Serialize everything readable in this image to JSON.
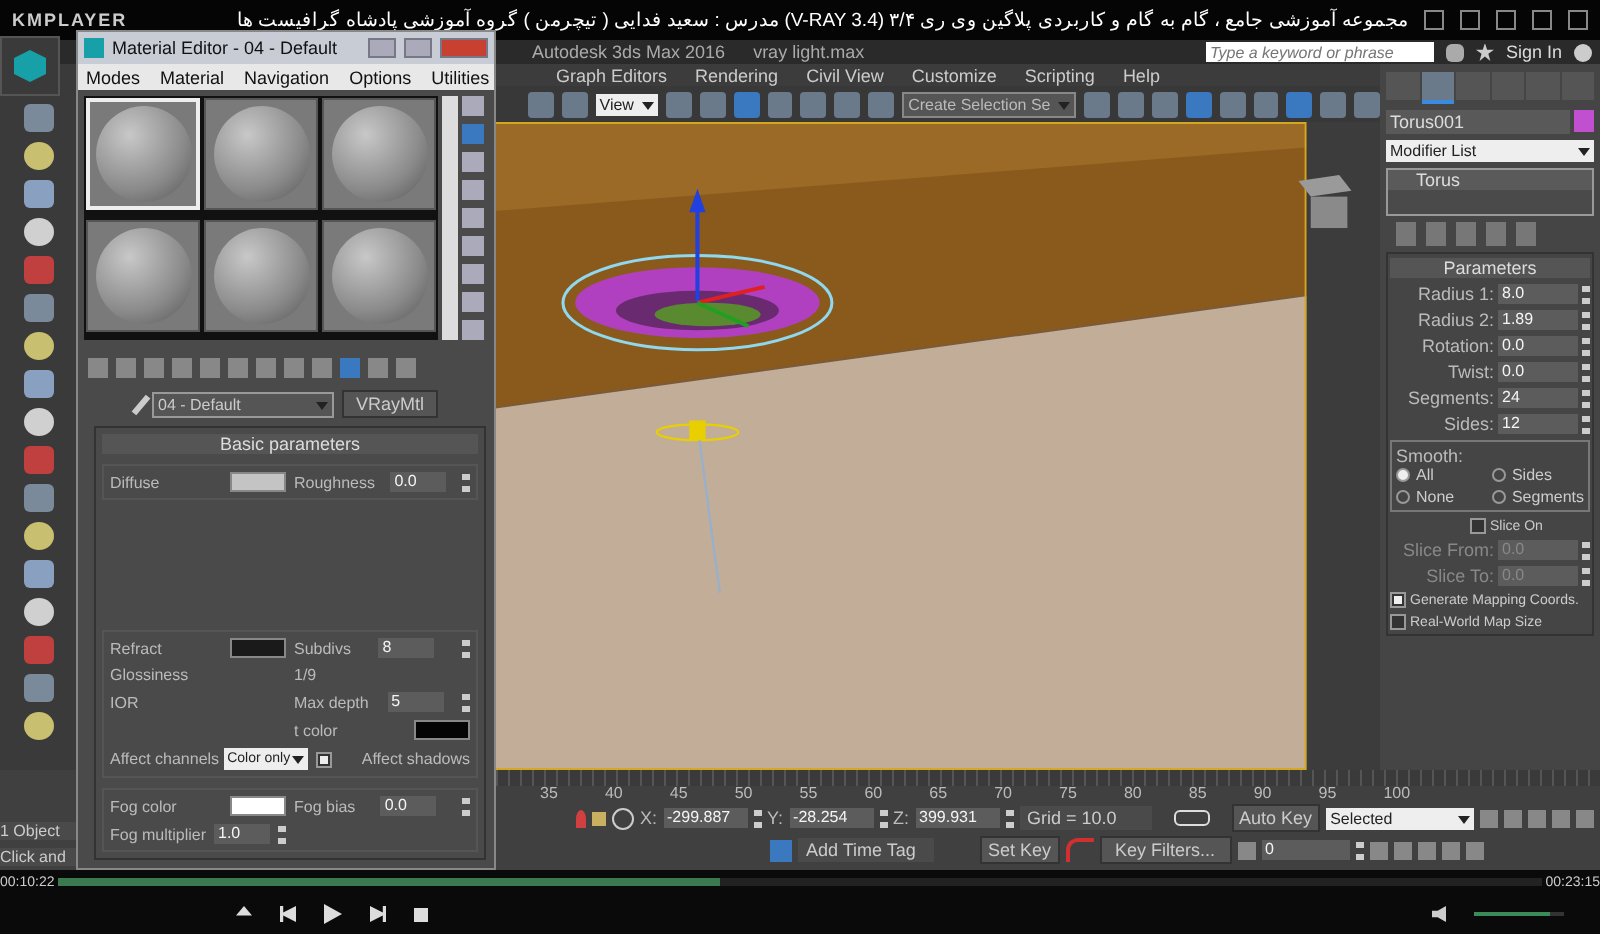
{
  "player": {
    "brand": "KMPLAYER",
    "title": "مجموعه آموزشی جامع ، گام به گام و کاربردی پلاگین وی ری ۳/۴ (V-RAY 3.4) مدرس : سعید فدایی ( تیچرمن ) گروه آموزشی پادشاه گرافیست ها",
    "time_elapsed": "00:10:22",
    "time_total": "00:23:15",
    "progress": {
      "level": 0.446
    },
    "volume": {
      "level": 0.85
    }
  },
  "app": {
    "title": "Autodesk 3ds Max 2016",
    "file": "vray light.max",
    "search": {
      "placeholder": "Type a keyword or phrase"
    },
    "sign_in": "Sign In"
  },
  "menu": [
    "Graph Editors",
    "Rendering",
    "Civil View",
    "Customize",
    "Scripting",
    "Help"
  ],
  "toolbar": {
    "view_dropdown": "View",
    "selection_set": "Create Selection Se"
  },
  "material_editor": {
    "title": "Material Editor - 04 - Default",
    "menu": [
      "Modes",
      "Material",
      "Navigation",
      "Options",
      "Utilities"
    ],
    "slots": [
      {
        "selected": true
      },
      {
        "selected": false
      },
      {
        "selected": false
      },
      {
        "selected": false
      },
      {
        "selected": false
      },
      {
        "selected": false
      }
    ],
    "material_name": "04 - Default",
    "material_type": "VRayMtl",
    "rollout": "Basic parameters",
    "sections": [
      [
        [
          {
            "kind": "swatch",
            "label": "Diffuse",
            "color": "#c4c4c4"
          },
          {
            "kind": "number",
            "label": "Roughness",
            "value": "0.0"
          }
        ]
      ],
      [
        [
          {
            "kind": "swatch",
            "label": "Refract",
            "color": "#1a1a1a"
          },
          {
            "kind": "number",
            "label": "Subdivs",
            "value": "8"
          }
        ],
        [
          {
            "kind": "label",
            "label": "Glossiness"
          },
          {
            "kind": "label",
            "label": "1/9"
          }
        ],
        [
          {
            "kind": "label",
            "label": "IOR"
          },
          {
            "kind": "number",
            "label": "Max depth",
            "value": "5"
          }
        ],
        [
          {
            "kind": "spacer"
          },
          {
            "kind": "swatch",
            "label": "t color",
            "color": "#050505"
          }
        ],
        [
          {
            "kind": "dropdown",
            "label": "Affect channels",
            "value": "Color only"
          },
          {
            "kind": "checkbox",
            "label": "Affect shadows",
            "checked": true
          }
        ]
      ],
      [
        [
          {
            "kind": "swatch",
            "label": "Fog color",
            "color": "#ffffff"
          },
          {
            "kind": "number",
            "label": "Fog bias",
            "value": "0.0"
          }
        ],
        [
          {
            "kind": "number",
            "label": "Fog multiplier",
            "value": "1.0"
          }
        ]
      ]
    ]
  },
  "status": [
    "1 Object",
    "Click and"
  ],
  "command_panel": {
    "tabs": [
      {
        "selected": false
      },
      {
        "selected": true
      },
      {
        "selected": false
      },
      {
        "selected": false
      },
      {
        "selected": false
      },
      {
        "selected": false
      }
    ],
    "object_name": "Torus001",
    "modifier_list": "Modifier List",
    "stack": [
      "Torus"
    ],
    "rollout": "Parameters",
    "fields": [
      {
        "label": "Radius 1:",
        "value": "8.0"
      },
      {
        "label": "Radius 2:",
        "value": "1.89"
      },
      {
        "label": "Rotation:",
        "value": "0.0"
      },
      {
        "label": "Twist:",
        "value": "0.0"
      },
      {
        "label": "Segments:",
        "value": "24"
      },
      {
        "label": "Sides:",
        "value": "12"
      }
    ],
    "smooth": {
      "label": "Smooth:",
      "options": [
        {
          "label": "All",
          "selected": true
        },
        {
          "label": "Sides",
          "selected": false
        },
        {
          "label": "None",
          "selected": false
        },
        {
          "label": "Segments",
          "selected": false
        }
      ]
    },
    "slice_on": {
      "label": "Slice On",
      "checked": false
    },
    "slice_fields": [
      {
        "label": "Slice From:",
        "value": "0.0",
        "disabled": true
      },
      {
        "label": "Slice To:",
        "value": "0.0",
        "disabled": true
      }
    ],
    "options": [
      {
        "label": "Generate Mapping Coords.",
        "checked": true
      },
      {
        "label": "Real-World Map Size",
        "checked": false
      }
    ]
  },
  "timeline": {
    "ticks": [
      "35",
      "40",
      "45",
      "50",
      "55",
      "60",
      "65",
      "70",
      "75",
      "80",
      "85",
      "90",
      "95",
      "100"
    ],
    "coords": [
      {
        "label": "X:",
        "value": "-299.887"
      },
      {
        "label": "Y:",
        "value": "-28.254"
      },
      {
        "label": "Z:",
        "value": "399.931"
      }
    ],
    "grid": "Grid = 10.0",
    "add_time_tag": "Add Time Tag",
    "auto_key": "Auto Key",
    "set_key": "Set Key",
    "key_mode": "Selected",
    "key_filters": "Key Filters...",
    "frame": "0"
  }
}
